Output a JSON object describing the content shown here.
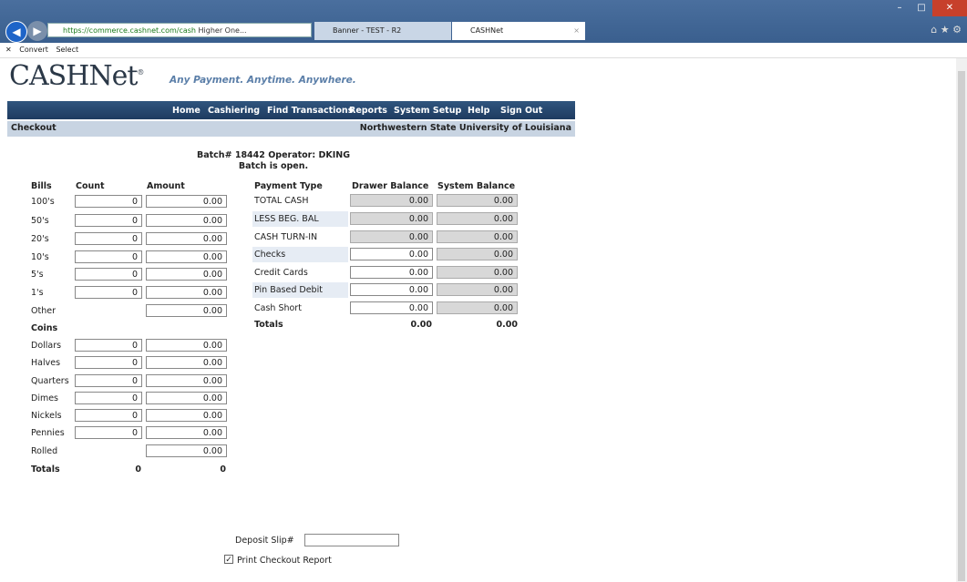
{
  "browser": {
    "url": "https://commerce.cashnet.com/cash",
    "url_rest": "Higher One...",
    "tabs": [
      {
        "label": "Banner - TEST - R2"
      },
      {
        "label": "CASHNet"
      }
    ],
    "tab_close": "×",
    "commands": {
      "convert": "Convert",
      "select": "Select"
    }
  },
  "header": {
    "logo": "CASHNet",
    "tagline": "Any Payment. Anytime. Anywhere."
  },
  "menu": [
    "Home",
    "Cashiering",
    "Find Transactions",
    "Reports",
    "System Setup",
    "Help",
    "Sign Out"
  ],
  "subheader": {
    "page": "Checkout",
    "institution": "Northwestern State University of Louisiana"
  },
  "batch": {
    "line1": "Batch# 18442  Operator: DKING",
    "line2": "Batch is open."
  },
  "left_table": {
    "headers": {
      "bills": "Bills",
      "count": "Count",
      "amount": "Amount"
    },
    "bills": [
      {
        "label": "100's",
        "count": "0",
        "amount": "0.00"
      },
      {
        "label": "50's",
        "count": "0",
        "amount": "0.00"
      },
      {
        "label": "20's",
        "count": "0",
        "amount": "0.00"
      },
      {
        "label": "10's",
        "count": "0",
        "amount": "0.00"
      },
      {
        "label": "5's",
        "count": "0",
        "amount": "0.00"
      },
      {
        "label": "1's",
        "count": "0",
        "amount": "0.00"
      },
      {
        "label": "Other",
        "count": "",
        "amount": "0.00"
      }
    ],
    "coins_header": "Coins",
    "coins": [
      {
        "label": "Dollars",
        "count": "0",
        "amount": "0.00"
      },
      {
        "label": "Halves",
        "count": "0",
        "amount": "0.00"
      },
      {
        "label": "Quarters",
        "count": "0",
        "amount": "0.00"
      },
      {
        "label": "Dimes",
        "count": "0",
        "amount": "0.00"
      },
      {
        "label": "Nickels",
        "count": "0",
        "amount": "0.00"
      },
      {
        "label": "Pennies",
        "count": "0",
        "amount": "0.00"
      },
      {
        "label": "Rolled",
        "count": "",
        "amount": "0.00"
      }
    ],
    "totals": {
      "label": "Totals",
      "count": "0",
      "amount": "0"
    }
  },
  "right_table": {
    "headers": {
      "type": "Payment Type",
      "drawer": "Drawer Balance",
      "system": "System Balance"
    },
    "rows": [
      {
        "label": "TOTAL CASH",
        "drawer": "0.00",
        "system": "0.00"
      },
      {
        "label": "LESS BEG. BAL",
        "drawer": "0.00",
        "system": "0.00"
      },
      {
        "label": "CASH TURN-IN",
        "drawer": "0.00",
        "system": "0.00"
      },
      {
        "label": "Checks",
        "drawer": "0.00",
        "system": "0.00"
      },
      {
        "label": "Credit Cards",
        "drawer": "0.00",
        "system": "0.00"
      },
      {
        "label": "Pin Based Debit",
        "drawer": "0.00",
        "system": "0.00"
      },
      {
        "label": "Cash Short",
        "drawer": "0.00",
        "system": "0.00"
      }
    ],
    "totals": {
      "label": "Totals",
      "drawer": "0.00",
      "system": "0.00"
    }
  },
  "footer": {
    "deposit_label": "Deposit Slip#",
    "deposit_value": "",
    "print_label": "Print Checkout Report",
    "print_checked": "✓"
  }
}
